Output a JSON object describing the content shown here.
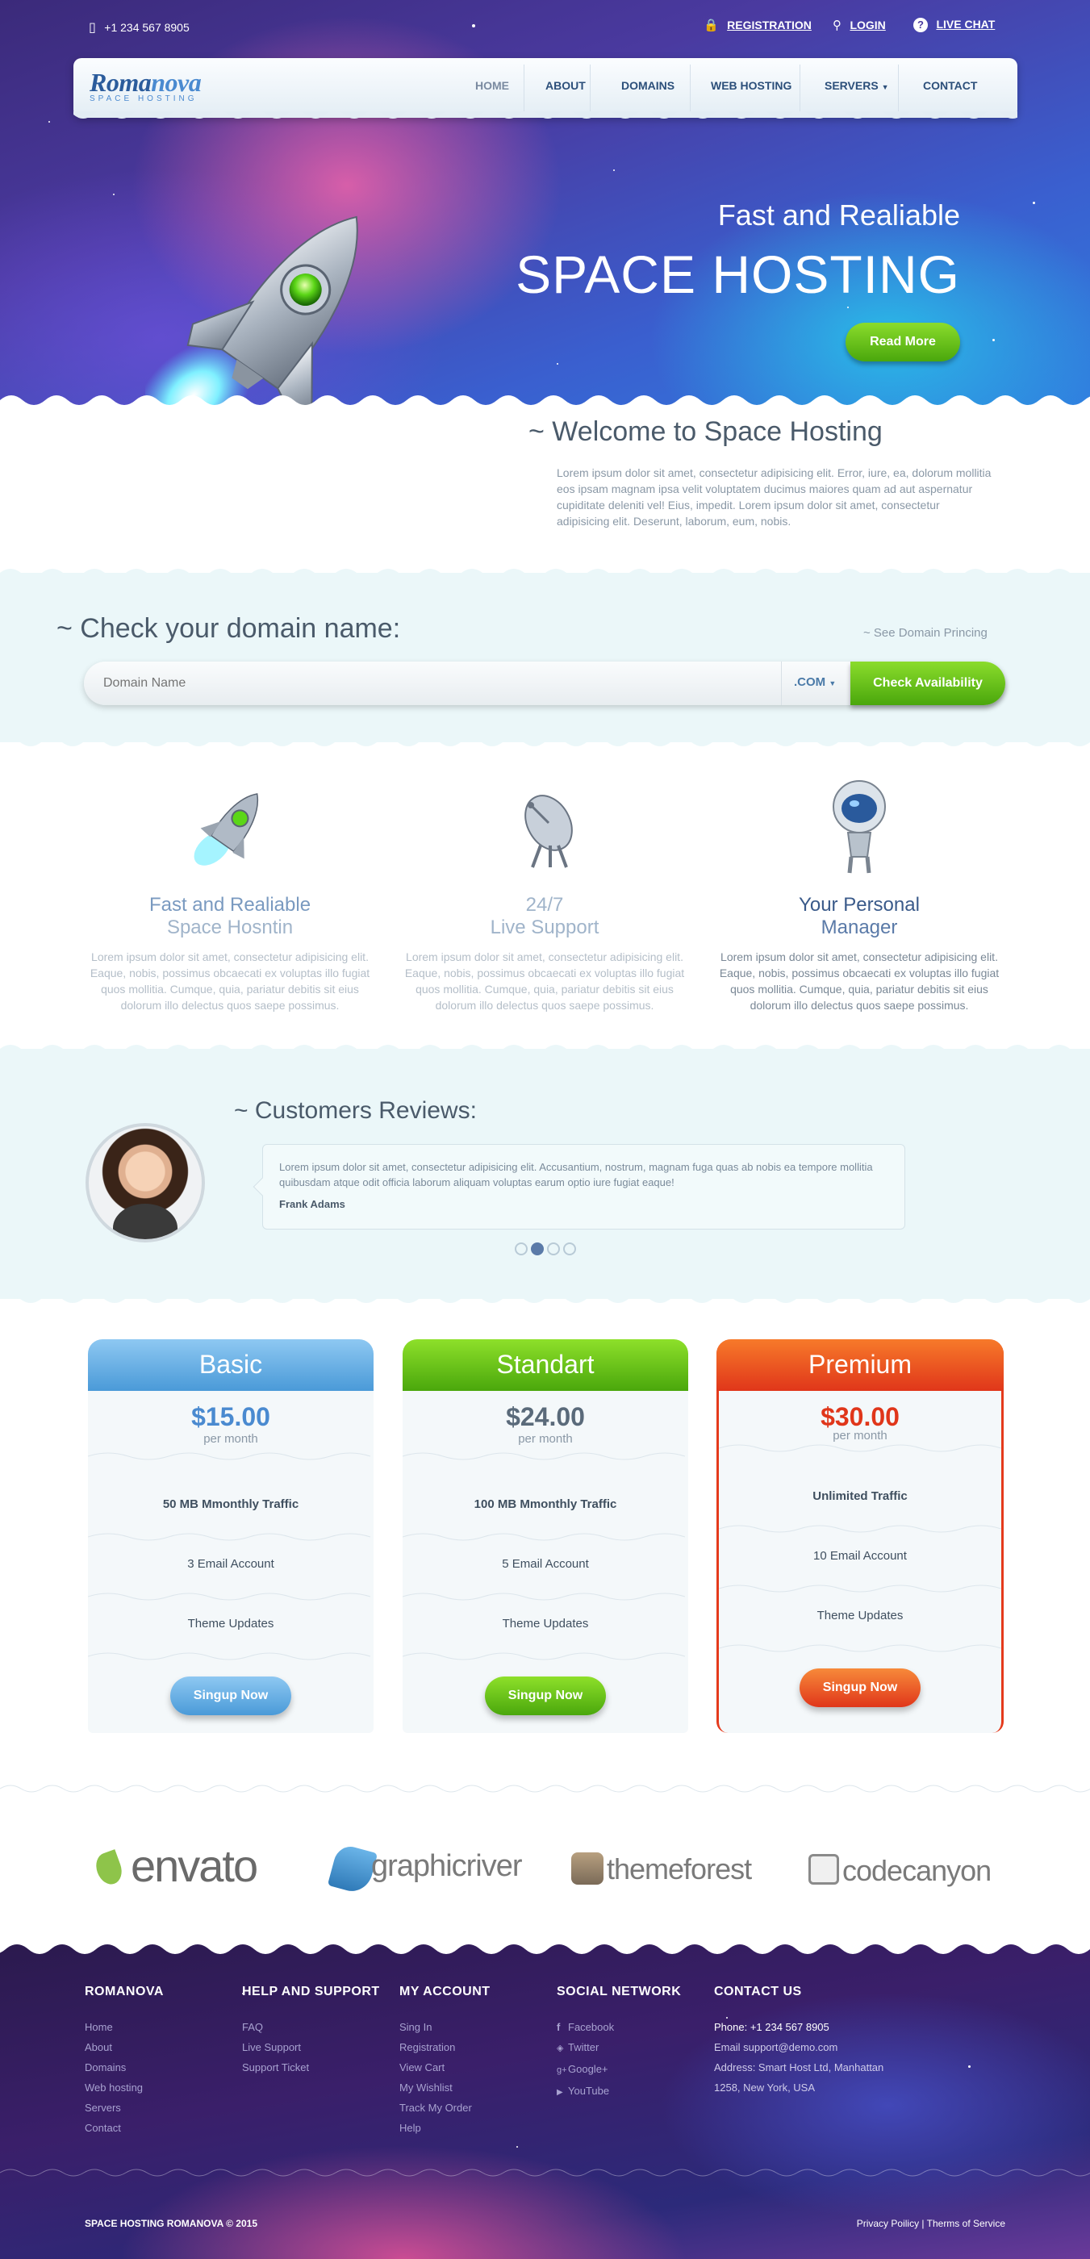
{
  "topbar": {
    "phone": "+1 234 567 8905",
    "registration": "REGISTRATION",
    "login": "LOGIN",
    "live_chat": "LIVE CHAT"
  },
  "logo": {
    "name_a": "Roma",
    "name_b": "nova",
    "tagline": "SPACE HOSTING"
  },
  "nav": [
    "HOME",
    "ABOUT",
    "DOMAINS",
    "WEB HOSTING",
    "SERVERS",
    "CONTACT"
  ],
  "hero": {
    "subtitle": "Fast and Realiable",
    "title": "SPACE HOSTING",
    "button": "Read More"
  },
  "welcome": {
    "title": "~ Welcome to Space Hosting",
    "text": "Lorem ipsum dolor sit amet, consectetur adipisicing elit. Error, iure, ea, dolorum mollitia eos ipsam magnam ipsa velit voluptatem ducimus maiores quam ad aut aspernatur cupiditate deleniti vel! Eius, impedit. Lorem ipsum dolor sit amet, consectetur adipisicing elit. Deserunt, laborum, eum, nobis."
  },
  "domain": {
    "title": "~ Check your domain name:",
    "pricing_link": "~ See Domain Princing",
    "placeholder": "Domain Name",
    "tld": ".COM",
    "button": "Check Availability"
  },
  "features": [
    {
      "title1": "Fast and Realiable",
      "title2": "Space Hosntin",
      "text": "Lorem ipsum dolor sit amet, consectetur adipisicing elit. Eaque, nobis, possimus obcaecati ex voluptas illo fugiat quos mollitia. Cumque, quia, pariatur debitis sit eius dolorum illo delectus quos saepe possimus."
    },
    {
      "title1": "24/7",
      "title2": "Live Support",
      "text": "Lorem ipsum dolor sit amet, consectetur adipisicing elit. Eaque, nobis, possimus obcaecati ex voluptas illo fugiat quos mollitia. Cumque, quia, pariatur debitis sit eius dolorum illo delectus quos saepe possimus."
    },
    {
      "title1": "Your Personal",
      "title2": "Manager",
      "text": "Lorem ipsum dolor sit amet, consectetur adipisicing elit. Eaque, nobis, possimus obcaecati ex voluptas illo fugiat quos mollitia. Cumque, quia, pariatur debitis sit eius dolorum illo delectus quos saepe possimus."
    }
  ],
  "reviews": {
    "title": "~ Customers Reviews:",
    "text": "Lorem ipsum dolor sit amet, consectetur adipisicing elit. Accusantium, nostrum, magnam fuga quas ab nobis ea tempore mollitia quibusdam atque odit officia laborum aliquam voluptas earum optio iure fugiat eaque!",
    "author": "Frank Adams",
    "active_dot": 2,
    "dot_count": 4
  },
  "pricing": [
    {
      "name": "Basic",
      "price": "$15.00",
      "per": "per month",
      "traffic": "50 MB Mmonthly Traffic",
      "email": "3 Email Account",
      "updates": "Theme Updates",
      "button": "Singup Now",
      "color": "#5aa6e0"
    },
    {
      "name": "Standart",
      "price": "$24.00",
      "per": "per month",
      "traffic": "100 MB Mmonthly Traffic",
      "email": "5 Email Account",
      "updates": "Theme Updates",
      "button": "Singup Now",
      "color": "#5cb80e"
    },
    {
      "name": "Premium",
      "price": "$30.00",
      "per": "per month",
      "traffic": "Unlimited Traffic",
      "email": "10 Email Account",
      "updates": "Theme Updates",
      "button": "Singup Now",
      "color": "#ec4b1e"
    }
  ],
  "partners": [
    "envato",
    "graphicriver",
    "themeforest",
    "codecanyon"
  ],
  "footer": {
    "col1": {
      "title": "ROMANOVA",
      "links": [
        "Home",
        "About",
        "Domains",
        "Web hosting",
        "Servers",
        "Contact"
      ]
    },
    "col2": {
      "title": "HELP AND SUPPORT",
      "links": [
        "FAQ",
        "Live Support",
        "Support Ticket"
      ]
    },
    "col3": {
      "title": "MY ACCOUNT",
      "links": [
        "Sing In",
        "Registration",
        "View Cart",
        "My Wishlist",
        "Track My Order",
        "Help"
      ]
    },
    "col4": {
      "title": "SOCIAL NETWORK",
      "links": [
        "Facebook",
        "Twitter",
        "Google+",
        "YouTube"
      ]
    },
    "col5": {
      "title": "CONTACT US",
      "phone": "Phone: +1 234 567 8905",
      "email": "Email support@demo.com",
      "address1": "Address: Smart Host Ltd, Manhattan",
      "address2": "1258, New York, USA"
    },
    "copyright": "SPACE HOSTING ROMANOVA © 2015",
    "privacy": "Privacy Poilicy | Therms of Service"
  }
}
